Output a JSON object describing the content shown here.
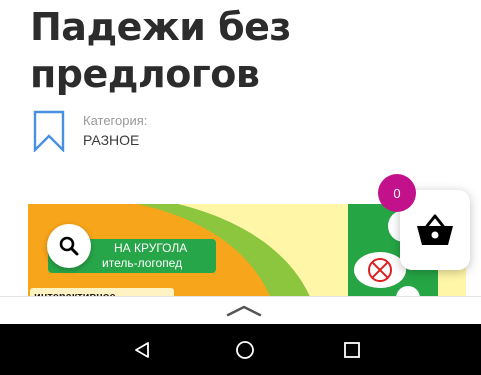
{
  "page": {
    "title": "Падежи без предлогов",
    "category_label": "Категория:",
    "category_value": "РАЗНОЕ"
  },
  "banner": {
    "line1": "НА КРУГОЛА",
    "line2": "итель-логопед",
    "tag": "интерактивное"
  },
  "cart": {
    "count": "0"
  },
  "icons": {
    "category": "bookmark-icon",
    "search": "search-icon",
    "cart": "basket-icon",
    "sheet_handle": "chevron-up-icon",
    "nav_back": "triangle-back-icon",
    "nav_home": "circle-home-icon",
    "nav_recents": "square-recents-icon"
  },
  "colors": {
    "title": "#2c2c2c",
    "category_icon": "#4a90e2",
    "badge": "#c2118b",
    "banner_green": "#26a545",
    "banner_orange": "#f7a51a",
    "banner_yellow": "#fff6a8"
  }
}
